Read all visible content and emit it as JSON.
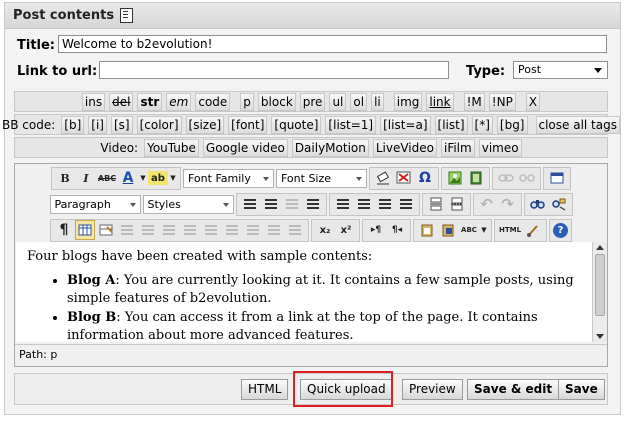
{
  "panel": {
    "title": "Post contents"
  },
  "title_field": {
    "label": "Title:",
    "value": "Welcome to b2evolution!"
  },
  "url_field": {
    "label": "Link to url:",
    "value": ""
  },
  "type_field": {
    "label": "Type:",
    "value": "Post"
  },
  "quicktags": {
    "row1": [
      "ins",
      "del",
      "str",
      "em",
      "code",
      "p",
      "block",
      "pre",
      "ul",
      "ol",
      "li",
      "img",
      "link",
      "!M",
      "!NP",
      "X"
    ],
    "bbcode_label": "BB code:",
    "bbcode": [
      "[b]",
      "[i]",
      "[s]",
      "[color]",
      "[size]",
      "[font]",
      "[quote]",
      "[list=1]",
      "[list=a]",
      "[list]",
      "[*]",
      "[bg]",
      "close all tags"
    ],
    "video_label": "Video:",
    "video": [
      "YouTube",
      "Google video",
      "DailyMotion",
      "LiveVideo",
      "iFilm",
      "vimeo"
    ]
  },
  "editor": {
    "font_family": "Font Family",
    "font_size": "Font Size",
    "format": "Paragraph",
    "styles": "Styles",
    "tb_bold": "B",
    "tb_italic": "I",
    "tb_strike": "ABC",
    "tb_forecolor": "A",
    "tb_highlight": "ab",
    "tb_omega": "Ω",
    "tb_pilcrow": "¶",
    "tb_sub": "x₂",
    "tb_sup": "x²",
    "tb_ltr": "▸¶",
    "tb_rtl": "¶◂",
    "tb_spell": "ABC",
    "tb_html": "HTML",
    "tb_help": "?",
    "content_intro": "Four blogs have been created with sample contents:",
    "items": [
      {
        "name": "Blog A",
        "text": ": You are currently looking at it. It contains a few sample posts, using simple features of b2evolution."
      },
      {
        "name": "Blog B",
        "text": ": You can access it from a link at the top of the page. It contains information about more advanced features."
      }
    ],
    "path": "Path: p"
  },
  "footer": {
    "html": "HTML",
    "quick_upload": "Quick upload",
    "preview": "Preview",
    "save_edit": "Save & edit",
    "save": "Save"
  },
  "colors": {
    "highlight_border": "#e02020",
    "panel_bg": "#f3f3f3"
  }
}
